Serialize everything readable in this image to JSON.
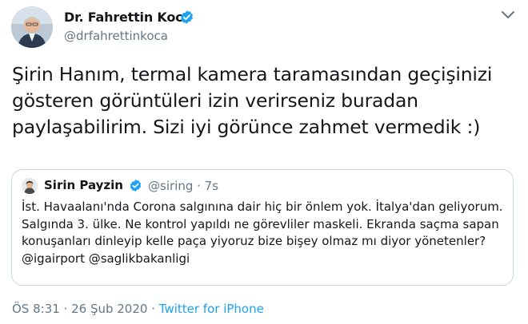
{
  "author": {
    "name": "Dr. Fahrettin Koca",
    "handle": "@drfahrettinkoca"
  },
  "tweet": {
    "text": "Şirin Hanım, termal kamera taramasından geçişinizi gösteren görüntüleri izin verirseniz buradan paylaşabilirim. Sizi iyi görünce zahmet vermedik :)"
  },
  "quoted": {
    "name": "Sirin Payzin",
    "handle_time": "@siring · 7s",
    "text": "İst. Havaalanı'nda Corona salgınına dair hiç bir önlem yok. İtalya'dan geliyorum. Salgında 3. ülke. Ne kontrol yapıldı ne görevliler maskeli. Ekranda saçma sapan konuşanları dinleyip kelle paça yiyoruz bize bişey olmaz mı diyor yönetenler?@igairport @saglikbakanligi"
  },
  "meta": {
    "time": "ÖS 8:31",
    "separator": " · ",
    "date": "26 Şub 2020",
    "source": "Twitter for iPhone"
  },
  "icons": {
    "verified": "verified-badge-icon",
    "more": "chevron-down-icon"
  },
  "colors": {
    "accent": "#1da1f2",
    "secondary_text": "#657786",
    "primary_text": "#14171a",
    "border": "#ccd6dd"
  }
}
